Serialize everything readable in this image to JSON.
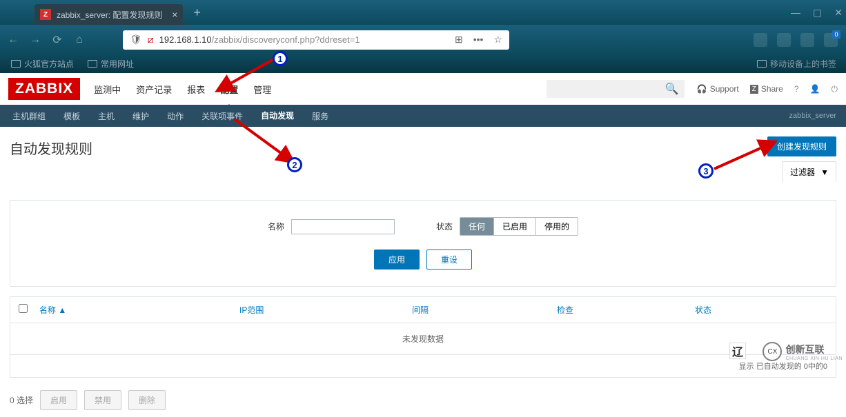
{
  "browser": {
    "tab_title": "zabbix_server: 配置发现规则",
    "url_host": "192.168.1.10",
    "url_path": "/zabbix/discoveryconf.php?ddreset=1",
    "bookmarks": [
      "火狐官方站点",
      "常用网址"
    ],
    "bookmark_right": "移动设备上的书签"
  },
  "zabbix": {
    "logo": "ZABBIX",
    "topmenu": [
      {
        "label": "监测中",
        "active": false
      },
      {
        "label": "资产记录",
        "active": false
      },
      {
        "label": "报表",
        "active": false
      },
      {
        "label": "配置",
        "active": true
      },
      {
        "label": "管理",
        "active": false
      }
    ],
    "toplinks": {
      "support": "Support",
      "share": "Share"
    },
    "submenu": [
      {
        "label": "主机群组",
        "active": false
      },
      {
        "label": "模板",
        "active": false
      },
      {
        "label": "主机",
        "active": false
      },
      {
        "label": "维护",
        "active": false
      },
      {
        "label": "动作",
        "active": false
      },
      {
        "label": "关联项事件",
        "active": false
      },
      {
        "label": "自动发现",
        "active": true
      },
      {
        "label": "服务",
        "active": false
      }
    ],
    "server_label": "zabbix_server",
    "page_title": "自动发现规则",
    "create_button": "创建发现规则",
    "filter_tab": "过滤器",
    "filter": {
      "name_label": "名称",
      "name_value": "",
      "status_label": "状态",
      "status_options": [
        "任何",
        "已启用",
        "停用的"
      ],
      "status_active": "任何",
      "apply": "应用",
      "reset": "重设"
    },
    "table": {
      "columns": {
        "name": "名称 ▲",
        "ip": "IP范围",
        "interval": "间隔",
        "check": "检查",
        "status": "状态"
      },
      "empty": "未发现数据",
      "footer": "显示 已自动发现的 0中的0"
    },
    "bulk": {
      "selected": "0 选择",
      "enable": "启用",
      "disable": "禁用",
      "delete": "删除"
    }
  },
  "annotations": {
    "marker1": "1",
    "marker2": "2",
    "marker3": "3"
  },
  "watermark": {
    "brand": "创新互联",
    "sub": "CHUANG XIN HU LIAN"
  }
}
